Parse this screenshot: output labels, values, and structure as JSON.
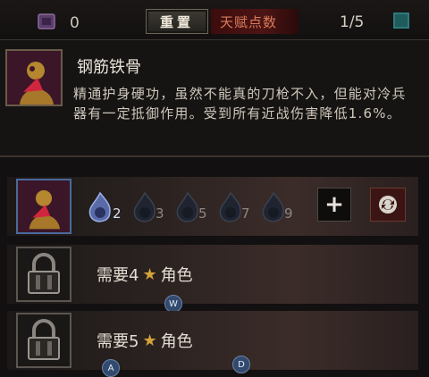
{
  "top_bar": {
    "currency_count": "0",
    "reset_label": "重置",
    "talent_points_label": "天赋点数",
    "talent_points_value": "1/5"
  },
  "tooltip": {
    "title": "钢筋铁骨",
    "description": "精通护身硬功，虽然不能真的刀枪不入，但能对冷兵器有一定抵御作用。受到所有近战伤害降低1.6%。"
  },
  "talent_row": {
    "ranks": [
      {
        "value": "2",
        "active": true
      },
      {
        "value": "3",
        "active": false
      },
      {
        "value": "5",
        "active": false
      },
      {
        "value": "7",
        "active": false
      },
      {
        "value": "9",
        "active": false
      }
    ],
    "plus_label": "+"
  },
  "locked_rows": [
    {
      "pre": "需要4",
      "post": "角色",
      "hint": "W"
    },
    {
      "pre": "需要5",
      "post": "角色",
      "hint": "A",
      "hint2": "D"
    }
  ],
  "colors": {
    "accent_blue": "#4a6a9a",
    "red_label": "#4d1414",
    "star_gold": "#d4a23a"
  }
}
